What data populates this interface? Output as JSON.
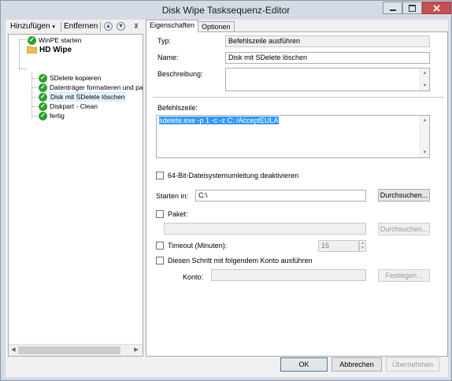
{
  "window": {
    "title": "Disk Wipe Tasksequenz-Editor"
  },
  "toolbar": {
    "add_label": "Hinzufügen",
    "add_arrow": "▾",
    "remove_label": "Entfernen",
    "up_icon": "▲",
    "down_icon": "▼",
    "pin_icon": "⊼"
  },
  "tree": {
    "items": [
      {
        "label": "WinPE starten",
        "icon": "check-icon"
      },
      {
        "label": "HD Wipe",
        "icon": "folder-icon",
        "bold": true
      },
      {
        "label": "SDelete kopieren",
        "icon": "check-icon"
      },
      {
        "label": "Datenträger formatieren und partit",
        "icon": "check-icon"
      },
      {
        "label": "Disk mit SDelete löschen",
        "icon": "check-icon",
        "selected": true
      },
      {
        "label": "Diskpart - Clean",
        "icon": "check-icon"
      },
      {
        "label": "fertig",
        "icon": "check-icon"
      }
    ],
    "check_glyph": "✓"
  },
  "tabs": {
    "properties": "Eigenschaften",
    "options": "Optionen"
  },
  "form": {
    "type_label": "Typ:",
    "type_value": "Befehlszeile ausführen",
    "name_label": "Name:",
    "name_value": "Disk mit SDelete löschen",
    "description_label": "Beschreibung:",
    "description_value": "",
    "commandline_label": "Befehlszeile:",
    "commandline_value": "sdelete.exe -p 1 -c -z C: /AcceptEULA",
    "redirect_label": "64-Bit-Dateisystemumleitung deaktivieren",
    "startin_label": "Starten in:",
    "startin_value": "C:\\",
    "browse_label": "Durchsuchen...",
    "package_label": "Paket:",
    "package_value": "",
    "browse2_label": "Durchsuchen...",
    "timeout_label": "Timeout (Minuten):",
    "timeout_value": "15",
    "runas_label": "Diesen Schritt mit folgendem Konto ausführen",
    "account_label": "Konto:",
    "account_value": "",
    "set_label": "Festlegen..."
  },
  "footer": {
    "ok": "OK",
    "cancel": "Abbrechen",
    "apply": "Übernehmen"
  },
  "colors": {
    "accent": "#3399ff",
    "check": "#2fa12f",
    "close": "#c75050"
  }
}
